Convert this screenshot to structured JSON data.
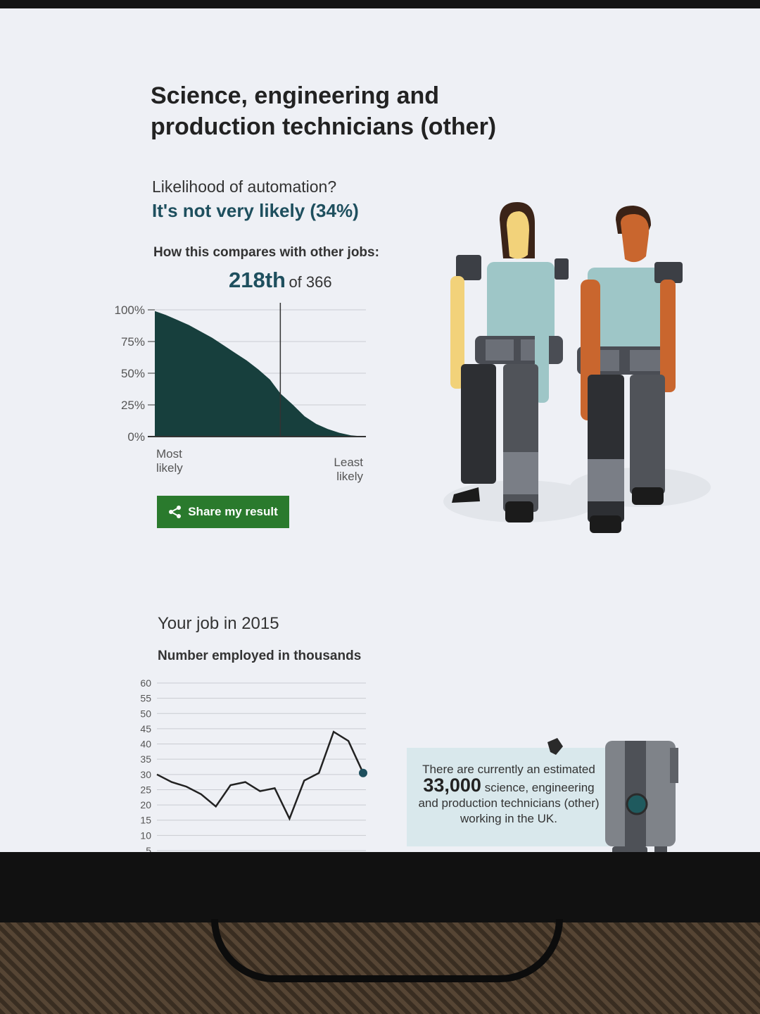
{
  "page": {
    "title": "Science, engineering and production technicians (other)",
    "question": "Likelihood of automation?",
    "answer": "It's not very likely (34%)",
    "compare_label": "How this compares with other jobs:",
    "rank": "218th",
    "rank_of": "of 366",
    "share_label": "Share my result",
    "job_title": "Your job in 2015",
    "job_subtitle": "Number employed in thousands",
    "info": {
      "prefix": "There are currently an estimated",
      "number": "33,000",
      "suffix": "science, engineering and production technicians (other) working in the UK."
    }
  },
  "colors": {
    "accent": "#1e4f5e",
    "distribution_fill": "#173f3d",
    "share_button": "#2a7a2d",
    "info_box": "#d9e8ec"
  },
  "icons": [
    "share-icon"
  ],
  "chart_data": [
    {
      "type": "area",
      "y_ticks": [
        "100%",
        "75%",
        "50%",
        "25%",
        "0%"
      ],
      "ylim": [
        0,
        100
      ],
      "x_labels": [
        "Most likely",
        "Least likely"
      ],
      "x_range": [
        1,
        366
      ],
      "marker_rank": 218,
      "marker_value": 34,
      "x": [
        1,
        20,
        40,
        60,
        80,
        100,
        120,
        140,
        160,
        180,
        200,
        218,
        240,
        260,
        280,
        300,
        320,
        340,
        366
      ],
      "values": [
        99,
        96,
        92,
        88,
        83,
        78,
        72,
        66,
        60,
        53,
        45,
        34,
        25,
        16,
        10,
        6,
        3,
        1,
        0
      ]
    },
    {
      "type": "line",
      "y_ticks": [
        "60",
        "55",
        "50",
        "45",
        "40",
        "35",
        "30",
        "25",
        "20",
        "15",
        "10",
        "5"
      ],
      "ylim": [
        5,
        60
      ],
      "values": [
        30,
        27.5,
        26,
        23.5,
        19.5,
        26.5,
        27.5,
        24.5,
        25.5,
        15.5,
        28,
        30.5,
        44,
        41,
        30.5
      ]
    }
  ]
}
